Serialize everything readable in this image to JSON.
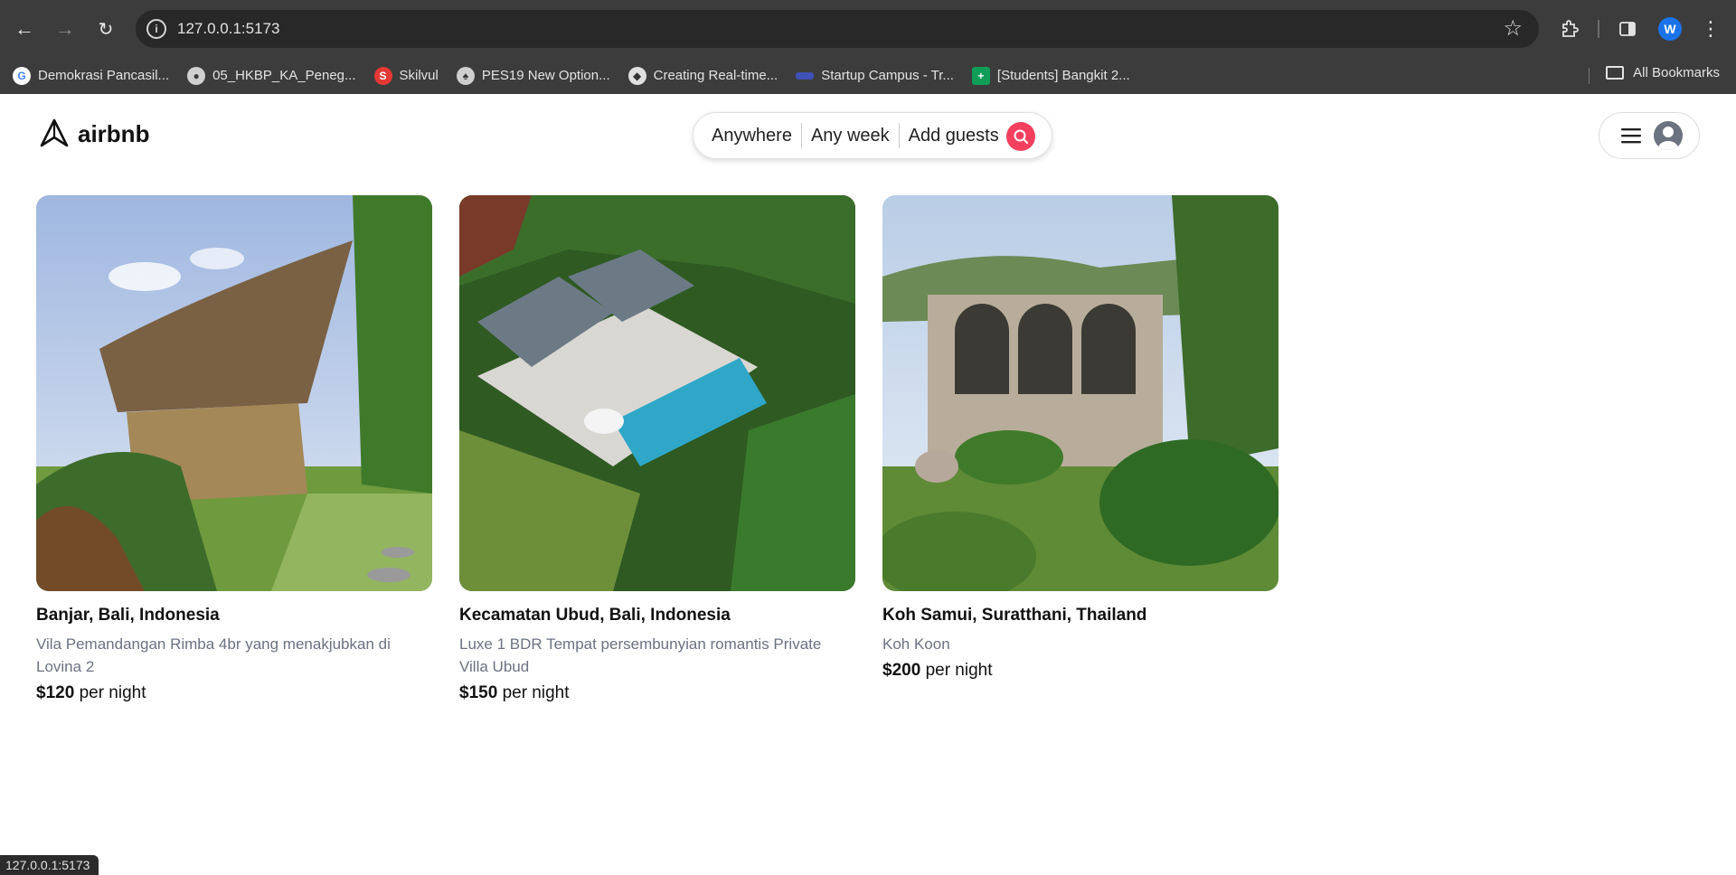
{
  "browser": {
    "url": "127.0.0.1:5173",
    "profile_initial": "W",
    "bookmarks": [
      {
        "label": "Demokrasi Pancasil...",
        "icon": "google-icon",
        "color": "#ffffff"
      },
      {
        "label": "05_HKBP_KA_Peneg...",
        "icon": "globe-icon",
        "color": "#d0d0d0"
      },
      {
        "label": "Skilvul",
        "icon": "skilvul-icon",
        "color": "#e53935"
      },
      {
        "label": "PES19 New Option...",
        "icon": "pes-icon",
        "color": "#cfcfcf"
      },
      {
        "label": "Creating Real-time...",
        "icon": "dev-icon",
        "color": "#e0e0e0"
      },
      {
        "label": "Startup Campus - Tr...",
        "icon": "startup-icon",
        "color": "#3f51b5"
      },
      {
        "label": "[Students] Bangkit 2...",
        "icon": "sheets-icon",
        "color": "#0f9d58"
      }
    ],
    "all_bookmarks": "All Bookmarks",
    "status_url": "127.0.0.1:5173"
  },
  "header": {
    "logo": "airbnb",
    "search": {
      "where": "Anywhere",
      "when": "Any week",
      "who": "Add guests"
    }
  },
  "listings": [
    {
      "title": "Banjar, Bali, Indonesia",
      "desc": "Vila Pemandangan Rimba 4br yang menakjubkan di Lovina 2",
      "price": "$120",
      "price_suffix": "per night"
    },
    {
      "title": "Kecamatan Ubud, Bali, Indonesia",
      "desc": "Luxe 1 BDR Tempat persembunyian romantis Private Villa Ubud",
      "price": "$150",
      "price_suffix": "per night"
    },
    {
      "title": "Koh Samui, Suratthani, Thailand",
      "desc": "Koh Koon",
      "price": "$200",
      "price_suffix": "per night"
    }
  ],
  "colors": {
    "accent": "#f43f5e"
  }
}
